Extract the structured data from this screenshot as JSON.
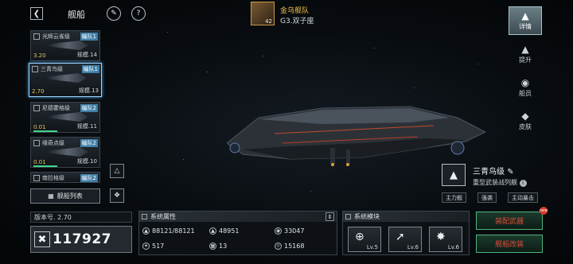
{
  "header": {
    "title": "舰船",
    "fleet_name": "金乌舰队",
    "fleet_sub": "G3.双子座",
    "fleet_level": "42"
  },
  "ships": [
    {
      "name": "光辉云雀级",
      "fleet": "编队1",
      "level": "3.20",
      "scale": "规模.14",
      "selected": false
    },
    {
      "name": "三青鸟级",
      "fleet": "编队1",
      "level": "2.70",
      "scale": "规模.13",
      "selected": true
    },
    {
      "name": "尼德霍格级",
      "fleet": "编队2",
      "level": "0.01",
      "scale": "规模.11",
      "selected": false
    },
    {
      "name": "缘奇点级",
      "fleet": "编队2",
      "level": "0.01",
      "scale": "规模.10",
      "selected": false
    },
    {
      "name": "南拉格级",
      "fleet": "编队2"
    }
  ],
  "fleet_list_label": "舰船列表",
  "nav": [
    {
      "label": "详情",
      "icon": "detail-icon",
      "active": true
    },
    {
      "label": "提升",
      "icon": "upgrade-icon",
      "active": false
    },
    {
      "label": "船员",
      "icon": "crew-icon",
      "active": false
    },
    {
      "label": "皮肤",
      "icon": "skin-icon",
      "active": false
    }
  ],
  "ship_info": {
    "class_name": "三青鸟级",
    "class_type": "重型武装战列舰",
    "roles": [
      "主力舰",
      "强袭",
      "主动暴击"
    ]
  },
  "version_label": "版本号. 2.70",
  "power": "117927",
  "attributes": {
    "title": "系统属性",
    "stats": [
      {
        "icon": "hull-icon",
        "value": "88121/88121"
      },
      {
        "icon": "armor-icon",
        "value": "48951"
      },
      {
        "icon": "shield-icon",
        "value": "33047"
      },
      {
        "icon": "speed-icon",
        "value": "517"
      },
      {
        "icon": "grid-icon",
        "value": "13"
      },
      {
        "icon": "energy-icon",
        "value": "15168"
      }
    ]
  },
  "modules": {
    "title": "系统模块",
    "slots": [
      {
        "icon": "target-icon",
        "level": "Lv.5"
      },
      {
        "icon": "missile-icon",
        "level": "Lv.6"
      },
      {
        "icon": "burst-icon",
        "level": "Lv.6"
      }
    ]
  },
  "actions": {
    "equip": "装配武器",
    "refit": "舰船改装",
    "badge": "new"
  }
}
